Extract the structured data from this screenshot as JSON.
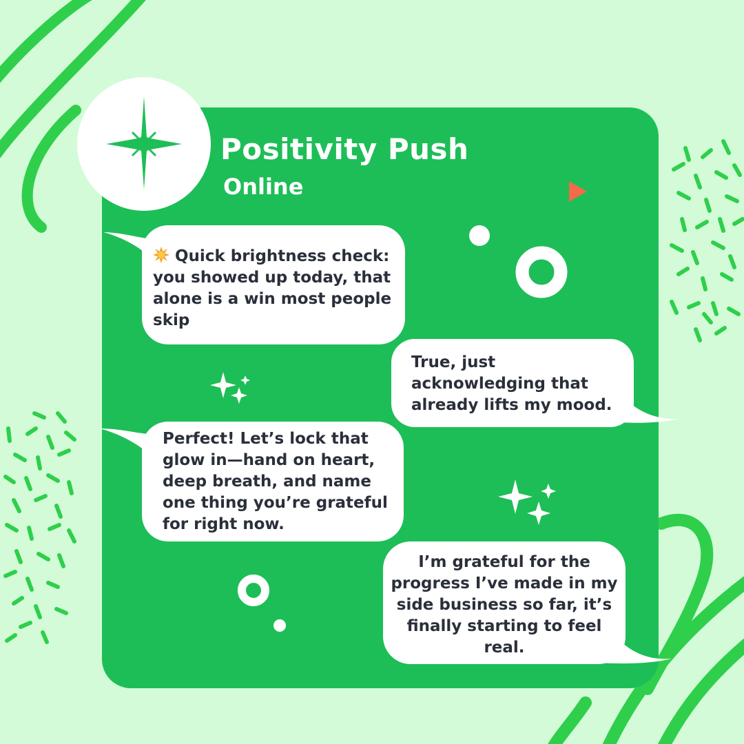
{
  "colors": {
    "background": "#d3fbd8",
    "card": "#1dbe57",
    "accent_green": "#2fcf4b",
    "bubble": "#ffffff",
    "text_dark": "#2a2f3a",
    "play_arrow": "#f26b4a",
    "sun_icon": "#f7a531"
  },
  "header": {
    "title": "Positivity Push",
    "status": "Online",
    "avatar_icon": "sparkle-star-icon"
  },
  "messages": [
    {
      "side": "left",
      "icon": "sun-icon",
      "text": "Quick brightness check: you showed up today, that alone is a win most people skip"
    },
    {
      "side": "right",
      "text": "True, just acknowledging that already lifts my mood."
    },
    {
      "side": "left",
      "text": "Perfect! Let’s lock that glow in—hand on heart, deep breath, and name one thing you’re grateful for right now."
    },
    {
      "side": "right",
      "text": "I’m grateful for the progress I’ve made in my side business so far, it’s finally starting to feel real."
    }
  ],
  "decorations": [
    "play-arrow-icon",
    "sparkles-icon",
    "ring-icon",
    "dot-icon",
    "confetti-pattern",
    "squiggle-stroke"
  ]
}
